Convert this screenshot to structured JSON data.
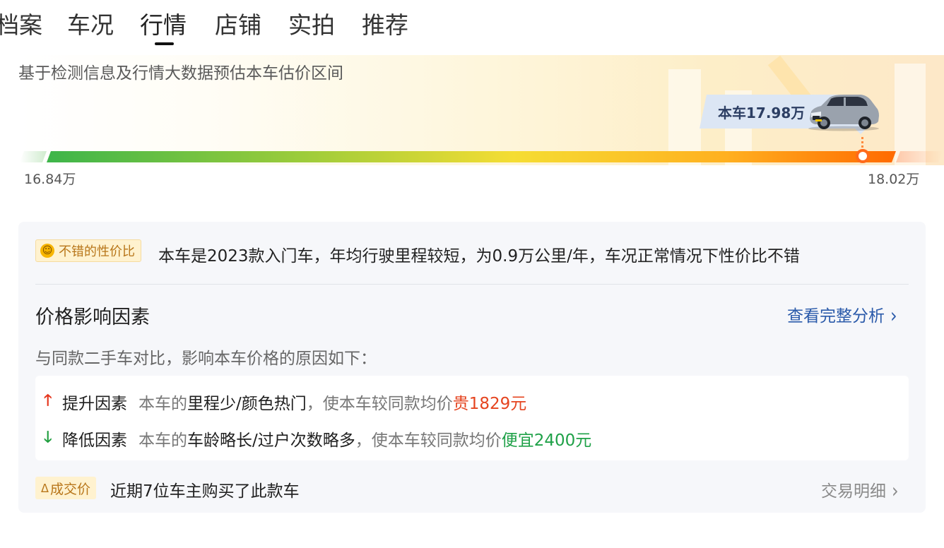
{
  "tabs": [
    {
      "label": "档案"
    },
    {
      "label": "车况"
    },
    {
      "label": "行情",
      "active": true
    },
    {
      "label": "店铺"
    },
    {
      "label": "实拍"
    },
    {
      "label": "推荐"
    }
  ],
  "price_range": {
    "description": "基于检测信息及行情大数据预估本车估价区间",
    "current_label": "本车17.98万",
    "min_label": "16.84万",
    "max_label": "18.02万",
    "min": 16.84,
    "max": 18.02,
    "current": 17.98
  },
  "summary": {
    "badge_icon": "smile-icon",
    "badge_label": "不错的性价比",
    "text": "本车是2023款入门车，年均行驶里程较短，为0.9万公里/年，车况正常情况下性价比不错"
  },
  "factors": {
    "title": "价格影响因素",
    "link_label": "查看完整分析",
    "description": "与同款二手车对比，影响本车价格的原因如下：",
    "up": {
      "icon": "arrow-up-icon",
      "label": "提升因素",
      "prefix": "本车的",
      "reasons": "里程少/颜色热门",
      "middle": "，使本车较同款均价",
      "result": "贵1829元"
    },
    "down": {
      "icon": "arrow-down-icon",
      "label": "降低因素",
      "prefix": "本车的",
      "reasons": "车龄略长/过户次数略多",
      "middle": "，使本车较同款均价",
      "result": "便宜2400元"
    }
  },
  "deal": {
    "badge_label": "成交价",
    "text": "近期7位车主购买了此款车",
    "link_label": "交易明细"
  },
  "colors": {
    "accent_blue": "#2a5aaa",
    "up_red": "#e5441f",
    "down_green": "#1fa148",
    "badge_bg": "#fff2cf",
    "badge_text": "#b8761a"
  }
}
